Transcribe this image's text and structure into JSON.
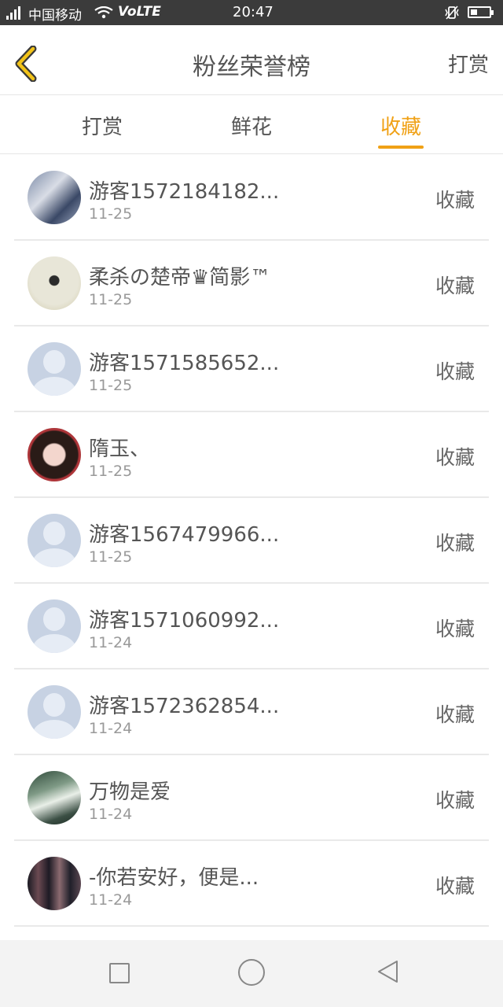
{
  "status_bar": {
    "network": "4G",
    "carrier": "中国移动",
    "volte": "VoLTE",
    "time": "20:47"
  },
  "header": {
    "title": "粉丝荣誉榜",
    "right_action": "打赏"
  },
  "tabs": [
    {
      "label": "打赏",
      "active": false
    },
    {
      "label": "鲜花",
      "active": false
    },
    {
      "label": "收藏",
      "active": true
    }
  ],
  "colors": {
    "accent": "#f0a116",
    "status_bar": "#3b3b3b",
    "text": "#555555",
    "subtext": "#999999"
  },
  "list": [
    {
      "name": "游客1572184182...",
      "date": "11-25",
      "action": "收藏",
      "avatar": "photo-boy"
    },
    {
      "name": "柔杀の楚帝♛简影™",
      "date": "11-25",
      "action": "收藏",
      "avatar": "photo-jumping-people"
    },
    {
      "name": "游客1571585652...",
      "date": "11-25",
      "action": "收藏",
      "avatar": "default-user"
    },
    {
      "name": "隋玉、",
      "date": "11-25",
      "action": "收藏",
      "avatar": "photo-girl"
    },
    {
      "name": "游客1567479966...",
      "date": "11-25",
      "action": "收藏",
      "avatar": "default-user"
    },
    {
      "name": "游客1571060992...",
      "date": "11-24",
      "action": "收藏",
      "avatar": "default-user"
    },
    {
      "name": "游客1572362854...",
      "date": "11-24",
      "action": "收藏",
      "avatar": "default-user"
    },
    {
      "name": "万物是爱",
      "date": "11-24",
      "action": "收藏",
      "avatar": "photo-dark-scene"
    },
    {
      "name": "-你若安好，便是...",
      "date": "11-24",
      "action": "收藏",
      "avatar": "photo-group"
    }
  ]
}
